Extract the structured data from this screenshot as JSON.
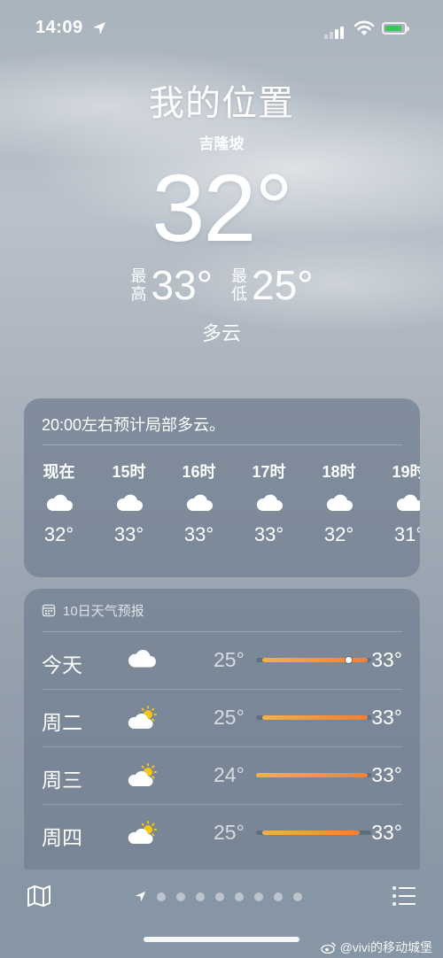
{
  "status_bar": {
    "time": "14:09"
  },
  "hero": {
    "location": "我的位置",
    "city": "吉隆坡",
    "temp": "32°",
    "high_label": "最高",
    "high": "33°",
    "low_label": "最低",
    "low": "25°",
    "condition": "多云"
  },
  "hourly": {
    "description": "20:00左右预计局部多云。",
    "items": [
      {
        "label": "现在",
        "icon": "cloud-icon",
        "temp": "32°"
      },
      {
        "label": "15时",
        "icon": "cloud-icon",
        "temp": "33°"
      },
      {
        "label": "16时",
        "icon": "cloud-icon",
        "temp": "33°"
      },
      {
        "label": "17时",
        "icon": "cloud-icon",
        "temp": "33°"
      },
      {
        "label": "18时",
        "icon": "cloud-icon",
        "temp": "32°"
      },
      {
        "label": "19时",
        "icon": "cloud-icon",
        "temp": "31°"
      }
    ]
  },
  "daily": {
    "title": "10日天气预报",
    "title_icon": "calendar-icon",
    "items": [
      {
        "day": "今天",
        "icon": "cloud-icon",
        "low": "25°",
        "high": "33°",
        "range_start": 0.05,
        "range_end": 0.97,
        "current_pos": 0.8
      },
      {
        "day": "周二",
        "icon": "partly-sunny-icon",
        "low": "25°",
        "high": "33°",
        "range_start": 0.05,
        "range_end": 0.97
      },
      {
        "day": "周三",
        "icon": "partly-sunny-icon",
        "low": "24°",
        "high": "33°",
        "range_start": 0.0,
        "range_end": 0.97
      },
      {
        "day": "周四",
        "icon": "partly-sunny-icon",
        "low": "25°",
        "high": "33°",
        "range_start": 0.05,
        "range_end": 0.9
      }
    ]
  },
  "bottom_bar": {
    "map_icon": "map-icon",
    "list_icon": "list-icon",
    "page_count": 8
  },
  "watermark": "@vivi的移动城堡",
  "colors": {
    "bar_start": "#f0b24a",
    "bar_end": "#f0803a",
    "battery": "#35c759"
  }
}
